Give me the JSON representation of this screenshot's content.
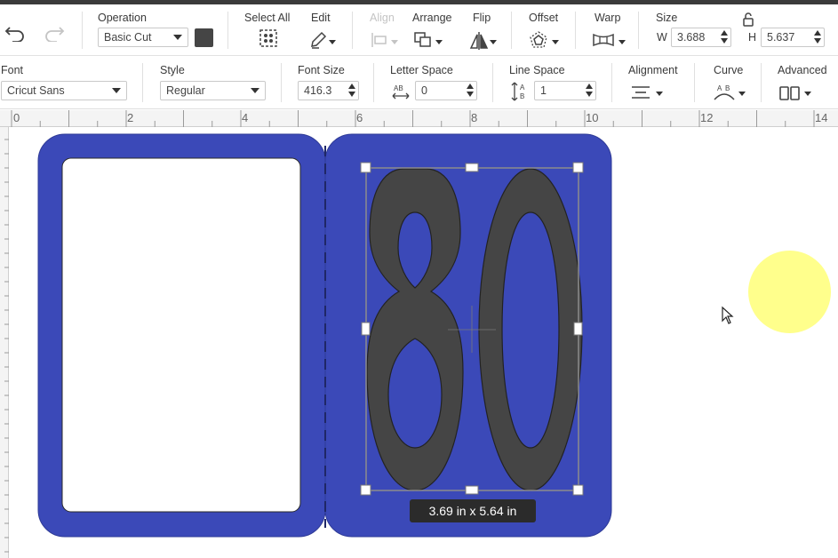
{
  "toolbar1": {
    "operation": {
      "label": "Operation",
      "value": "Basic Cut",
      "color": "#454545"
    },
    "select_all": {
      "label": "Select All"
    },
    "edit": {
      "label": "Edit"
    },
    "align": {
      "label": "Align"
    },
    "arrange": {
      "label": "Arrange"
    },
    "flip": {
      "label": "Flip"
    },
    "offset": {
      "label": "Offset"
    },
    "warp": {
      "label": "Warp"
    },
    "size": {
      "label": "Size",
      "w_label": "W",
      "w_value": "3.688",
      "h_label": "H",
      "h_value": "5.637"
    }
  },
  "toolbar2": {
    "font": {
      "label": "Font",
      "value": "Cricut Sans"
    },
    "style": {
      "label": "Style",
      "value": "Regular"
    },
    "font_size": {
      "label": "Font Size",
      "value": "416.3"
    },
    "letter_space": {
      "label": "Letter Space",
      "value": "0"
    },
    "line_space": {
      "label": "Line Space",
      "value": "1"
    },
    "alignment": {
      "label": "Alignment"
    },
    "curve": {
      "label": "Curve"
    },
    "advanced": {
      "label": "Advanced"
    }
  },
  "ruler": {
    "ticks": [
      "0",
      "2",
      "4",
      "6",
      "8",
      "10",
      "12",
      "14"
    ]
  },
  "canvas": {
    "card_color": "#3b49b8",
    "text_color": "#454545",
    "text_content": "80",
    "selection_dimensions": "3.69  in x 5.64  in"
  },
  "colors": {
    "accent_blue": "#3b49b8",
    "cursor_highlight": "#ffff80"
  }
}
